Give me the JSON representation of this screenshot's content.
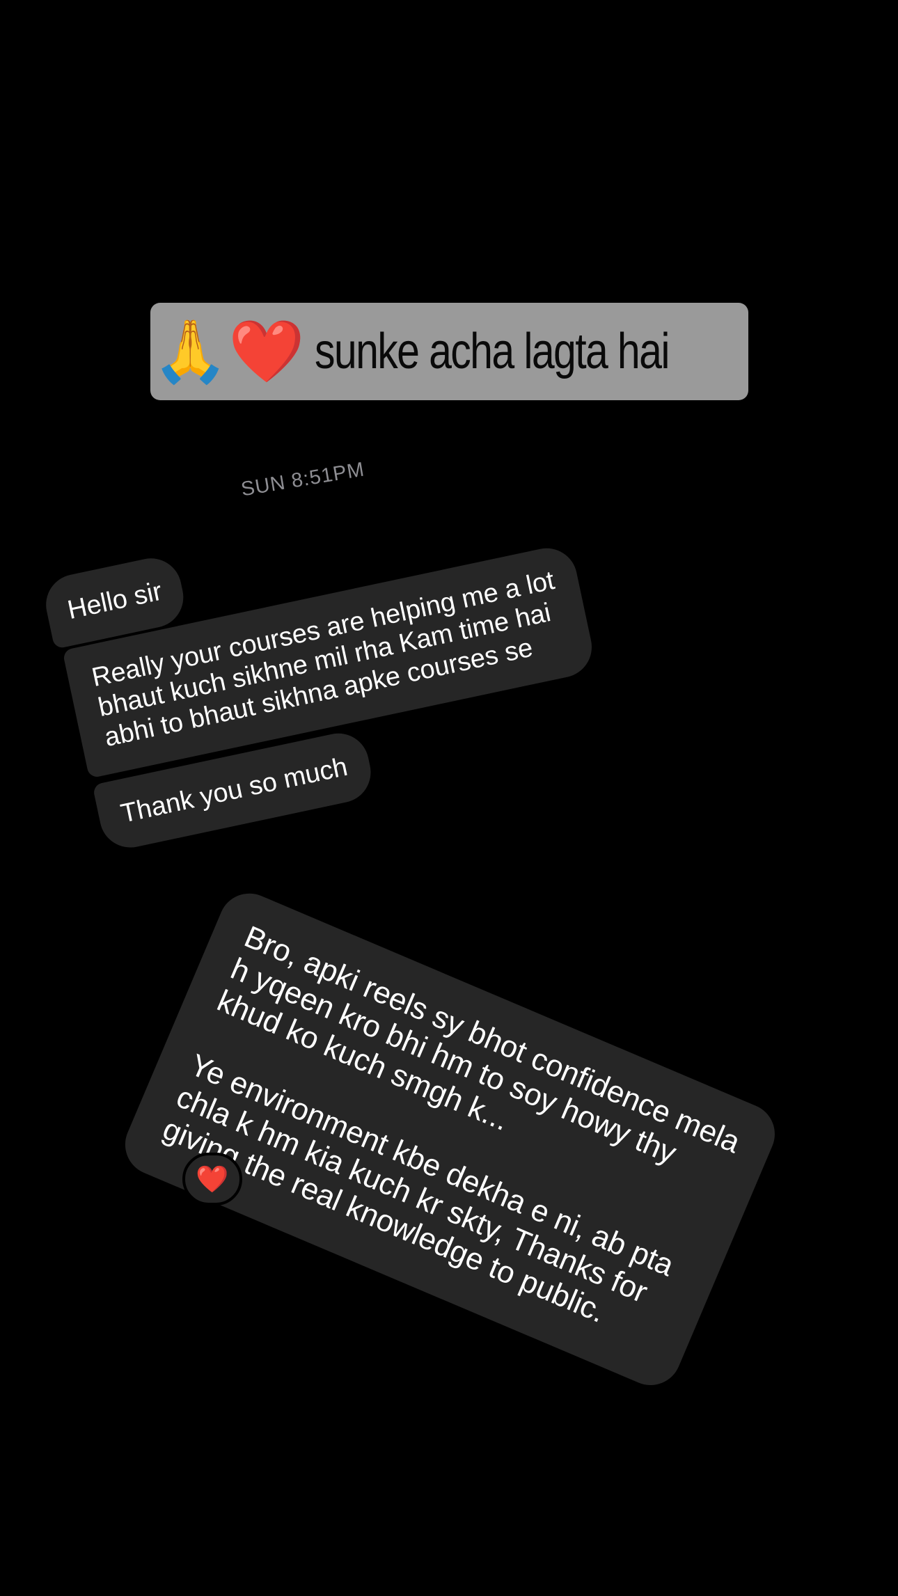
{
  "caption": {
    "emoji": "🙏❤️",
    "text": "sunke acha lagta hai"
  },
  "chat": {
    "timestamp": "SUN 8:51PM",
    "received": {
      "hello": "Hello sir",
      "courses": [
        "Really your courses are helping me a lot",
        "bhaut kuch sikhne mil rha Kam time hai",
        "abhi to bhaut sikhna apke courses se"
      ],
      "thanks": "Thank you so much"
    },
    "sent": {
      "paragraph1": [
        "Bro, apki reels sy bhot confidence mela",
        "h yqeen kro bhi hm to soy howy thy",
        "khud ko kuch smgh k..."
      ],
      "paragraph2": [
        "Ye environment kbe dekha e ni, ab pta",
        "chla k hm kia kuch kr skty, Thanks for",
        "giving the real knowledge to public."
      ]
    },
    "reaction": {
      "emoji": "❤️"
    }
  }
}
